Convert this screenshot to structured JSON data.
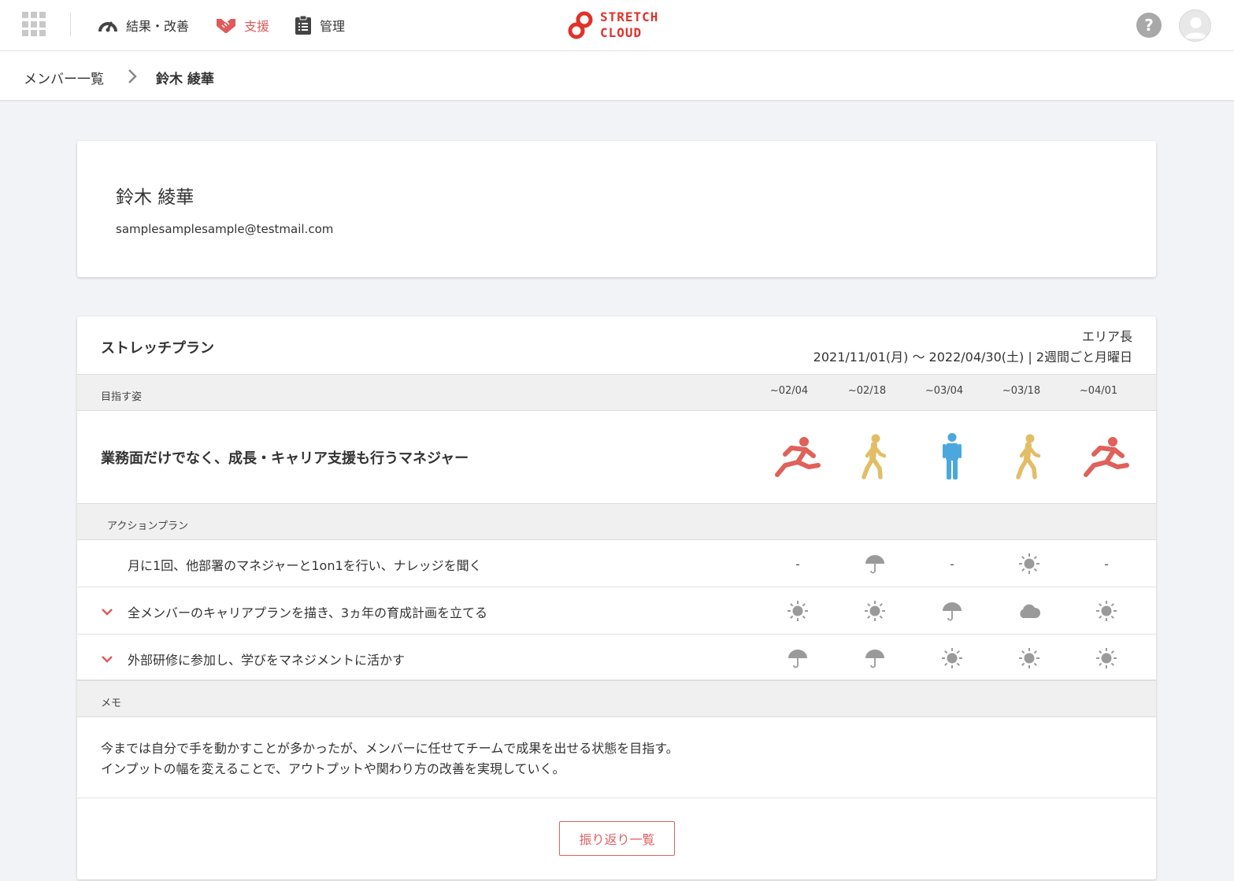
{
  "nav": {
    "results_label": "結果・改善",
    "support_label": "支援",
    "manage_label": "管理"
  },
  "logo": {
    "line1": "STRETCH",
    "line2": "CLOUD"
  },
  "help_label": "?",
  "breadcrumb": {
    "parent": "メンバー一覧",
    "current": "鈴木 綾華"
  },
  "profile": {
    "name": "鈴木 綾華",
    "email": "samplesamplesample@testmail.com"
  },
  "plan": {
    "title": "ストレッチプラン",
    "role": "エリア長",
    "period": "2021/11/01(月) 〜 2022/04/30(土) | 2週間ごと月曜日",
    "goal_header": "目指す姿",
    "dates": [
      "~02/04",
      "~02/18",
      "~03/04",
      "~03/18",
      "~04/01"
    ],
    "goal": "業務面だけでなく、成長・キャリア支援も行うマネジャー",
    "goal_figures": [
      "running",
      "walking",
      "standing",
      "walking",
      "running"
    ],
    "action_header": "アクションプラン",
    "actions": [
      {
        "label": "月に1回、他部署のマネジャーと1on1を行い、ナレッジを聞く",
        "expandable": false,
        "weather": [
          "-",
          "umbrella",
          "-",
          "sun",
          "-"
        ]
      },
      {
        "label": "全メンバーのキャリアプランを描き、3ヵ年の育成計画を立てる",
        "expandable": true,
        "weather": [
          "sun",
          "sun",
          "umbrella",
          "cloud",
          "sun"
        ]
      },
      {
        "label": "外部研修に参加し、学びをマネジメントに活かす",
        "expandable": true,
        "weather": [
          "umbrella",
          "umbrella",
          "sun",
          "sun",
          "sun"
        ]
      }
    ],
    "memo_header": "メモ",
    "memo_line1": "今までは自分で手を動かすことが多かったが、メンバーに任せてチームで成果を出せる状態を目指す。",
    "memo_line2": "インプットの幅を変えることで、アウトプットや関わり方の改善を実現していく。",
    "review_button": "振り返り一覧"
  },
  "colors": {
    "accent": "#e05a5a",
    "logo": "#e0322b",
    "running": "#e0605a",
    "walking": "#e3bd66",
    "standing": "#4aa8dc",
    "weather_icon": "#9a9a9a"
  }
}
